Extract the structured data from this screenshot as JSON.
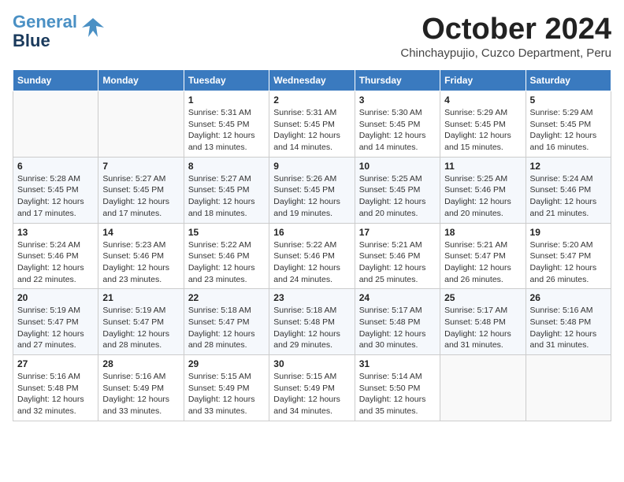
{
  "logo": {
    "line1": "General",
    "line2": "Blue"
  },
  "title": "October 2024",
  "subtitle": "Chinchaypujio, Cuzco Department, Peru",
  "days_of_week": [
    "Sunday",
    "Monday",
    "Tuesday",
    "Wednesday",
    "Thursday",
    "Friday",
    "Saturday"
  ],
  "weeks": [
    [
      {
        "day": "",
        "sunrise": "",
        "sunset": "",
        "daylight": ""
      },
      {
        "day": "",
        "sunrise": "",
        "sunset": "",
        "daylight": ""
      },
      {
        "day": "1",
        "sunrise": "Sunrise: 5:31 AM",
        "sunset": "Sunset: 5:45 PM",
        "daylight": "Daylight: 12 hours and 13 minutes."
      },
      {
        "day": "2",
        "sunrise": "Sunrise: 5:31 AM",
        "sunset": "Sunset: 5:45 PM",
        "daylight": "Daylight: 12 hours and 14 minutes."
      },
      {
        "day": "3",
        "sunrise": "Sunrise: 5:30 AM",
        "sunset": "Sunset: 5:45 PM",
        "daylight": "Daylight: 12 hours and 14 minutes."
      },
      {
        "day": "4",
        "sunrise": "Sunrise: 5:29 AM",
        "sunset": "Sunset: 5:45 PM",
        "daylight": "Daylight: 12 hours and 15 minutes."
      },
      {
        "day": "5",
        "sunrise": "Sunrise: 5:29 AM",
        "sunset": "Sunset: 5:45 PM",
        "daylight": "Daylight: 12 hours and 16 minutes."
      }
    ],
    [
      {
        "day": "6",
        "sunrise": "Sunrise: 5:28 AM",
        "sunset": "Sunset: 5:45 PM",
        "daylight": "Daylight: 12 hours and 17 minutes."
      },
      {
        "day": "7",
        "sunrise": "Sunrise: 5:27 AM",
        "sunset": "Sunset: 5:45 PM",
        "daylight": "Daylight: 12 hours and 17 minutes."
      },
      {
        "day": "8",
        "sunrise": "Sunrise: 5:27 AM",
        "sunset": "Sunset: 5:45 PM",
        "daylight": "Daylight: 12 hours and 18 minutes."
      },
      {
        "day": "9",
        "sunrise": "Sunrise: 5:26 AM",
        "sunset": "Sunset: 5:45 PM",
        "daylight": "Daylight: 12 hours and 19 minutes."
      },
      {
        "day": "10",
        "sunrise": "Sunrise: 5:25 AM",
        "sunset": "Sunset: 5:45 PM",
        "daylight": "Daylight: 12 hours and 20 minutes."
      },
      {
        "day": "11",
        "sunrise": "Sunrise: 5:25 AM",
        "sunset": "Sunset: 5:46 PM",
        "daylight": "Daylight: 12 hours and 20 minutes."
      },
      {
        "day": "12",
        "sunrise": "Sunrise: 5:24 AM",
        "sunset": "Sunset: 5:46 PM",
        "daylight": "Daylight: 12 hours and 21 minutes."
      }
    ],
    [
      {
        "day": "13",
        "sunrise": "Sunrise: 5:24 AM",
        "sunset": "Sunset: 5:46 PM",
        "daylight": "Daylight: 12 hours and 22 minutes."
      },
      {
        "day": "14",
        "sunrise": "Sunrise: 5:23 AM",
        "sunset": "Sunset: 5:46 PM",
        "daylight": "Daylight: 12 hours and 23 minutes."
      },
      {
        "day": "15",
        "sunrise": "Sunrise: 5:22 AM",
        "sunset": "Sunset: 5:46 PM",
        "daylight": "Daylight: 12 hours and 23 minutes."
      },
      {
        "day": "16",
        "sunrise": "Sunrise: 5:22 AM",
        "sunset": "Sunset: 5:46 PM",
        "daylight": "Daylight: 12 hours and 24 minutes."
      },
      {
        "day": "17",
        "sunrise": "Sunrise: 5:21 AM",
        "sunset": "Sunset: 5:46 PM",
        "daylight": "Daylight: 12 hours and 25 minutes."
      },
      {
        "day": "18",
        "sunrise": "Sunrise: 5:21 AM",
        "sunset": "Sunset: 5:47 PM",
        "daylight": "Daylight: 12 hours and 26 minutes."
      },
      {
        "day": "19",
        "sunrise": "Sunrise: 5:20 AM",
        "sunset": "Sunset: 5:47 PM",
        "daylight": "Daylight: 12 hours and 26 minutes."
      }
    ],
    [
      {
        "day": "20",
        "sunrise": "Sunrise: 5:19 AM",
        "sunset": "Sunset: 5:47 PM",
        "daylight": "Daylight: 12 hours and 27 minutes."
      },
      {
        "day": "21",
        "sunrise": "Sunrise: 5:19 AM",
        "sunset": "Sunset: 5:47 PM",
        "daylight": "Daylight: 12 hours and 28 minutes."
      },
      {
        "day": "22",
        "sunrise": "Sunrise: 5:18 AM",
        "sunset": "Sunset: 5:47 PM",
        "daylight": "Daylight: 12 hours and 28 minutes."
      },
      {
        "day": "23",
        "sunrise": "Sunrise: 5:18 AM",
        "sunset": "Sunset: 5:48 PM",
        "daylight": "Daylight: 12 hours and 29 minutes."
      },
      {
        "day": "24",
        "sunrise": "Sunrise: 5:17 AM",
        "sunset": "Sunset: 5:48 PM",
        "daylight": "Daylight: 12 hours and 30 minutes."
      },
      {
        "day": "25",
        "sunrise": "Sunrise: 5:17 AM",
        "sunset": "Sunset: 5:48 PM",
        "daylight": "Daylight: 12 hours and 31 minutes."
      },
      {
        "day": "26",
        "sunrise": "Sunrise: 5:16 AM",
        "sunset": "Sunset: 5:48 PM",
        "daylight": "Daylight: 12 hours and 31 minutes."
      }
    ],
    [
      {
        "day": "27",
        "sunrise": "Sunrise: 5:16 AM",
        "sunset": "Sunset: 5:48 PM",
        "daylight": "Daylight: 12 hours and 32 minutes."
      },
      {
        "day": "28",
        "sunrise": "Sunrise: 5:16 AM",
        "sunset": "Sunset: 5:49 PM",
        "daylight": "Daylight: 12 hours and 33 minutes."
      },
      {
        "day": "29",
        "sunrise": "Sunrise: 5:15 AM",
        "sunset": "Sunset: 5:49 PM",
        "daylight": "Daylight: 12 hours and 33 minutes."
      },
      {
        "day": "30",
        "sunrise": "Sunrise: 5:15 AM",
        "sunset": "Sunset: 5:49 PM",
        "daylight": "Daylight: 12 hours and 34 minutes."
      },
      {
        "day": "31",
        "sunrise": "Sunrise: 5:14 AM",
        "sunset": "Sunset: 5:50 PM",
        "daylight": "Daylight: 12 hours and 35 minutes."
      },
      {
        "day": "",
        "sunrise": "",
        "sunset": "",
        "daylight": ""
      },
      {
        "day": "",
        "sunrise": "",
        "sunset": "",
        "daylight": ""
      }
    ]
  ]
}
